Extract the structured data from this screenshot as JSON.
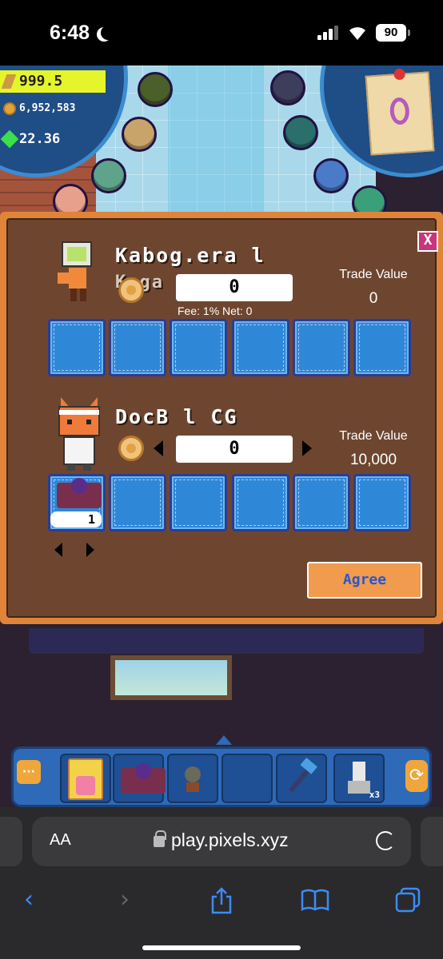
{
  "status_bar": {
    "time": "6:48",
    "battery": "90"
  },
  "hud": {
    "energy": "999.5",
    "coins": "6,952,583",
    "gems": "22.36"
  },
  "trade": {
    "top_player": {
      "name": "Kabog.era l",
      "name_line2": "Kaga",
      "amount": "0",
      "fee_text": "Fee: 1% Net: 0",
      "trade_value_label": "Trade Value",
      "trade_value": "0"
    },
    "bottom_player": {
      "name": "DocB l CG",
      "amount": "0",
      "trade_value_label": "Trade Value",
      "trade_value": "10,000",
      "slot_qty": "1"
    },
    "agree_label": "Agree",
    "close_label": "X"
  },
  "hotbar": {
    "tool_qty": "x3"
  },
  "browser": {
    "aa_label": "AA",
    "url": "play.pixels.xyz"
  },
  "colors": {
    "panel_border": "#e0843a",
    "panel_bg": "#6e4630",
    "slot_blue": "#2f87d8",
    "agree_text": "#2d57c9",
    "hotbar": "#2e6ab7"
  }
}
